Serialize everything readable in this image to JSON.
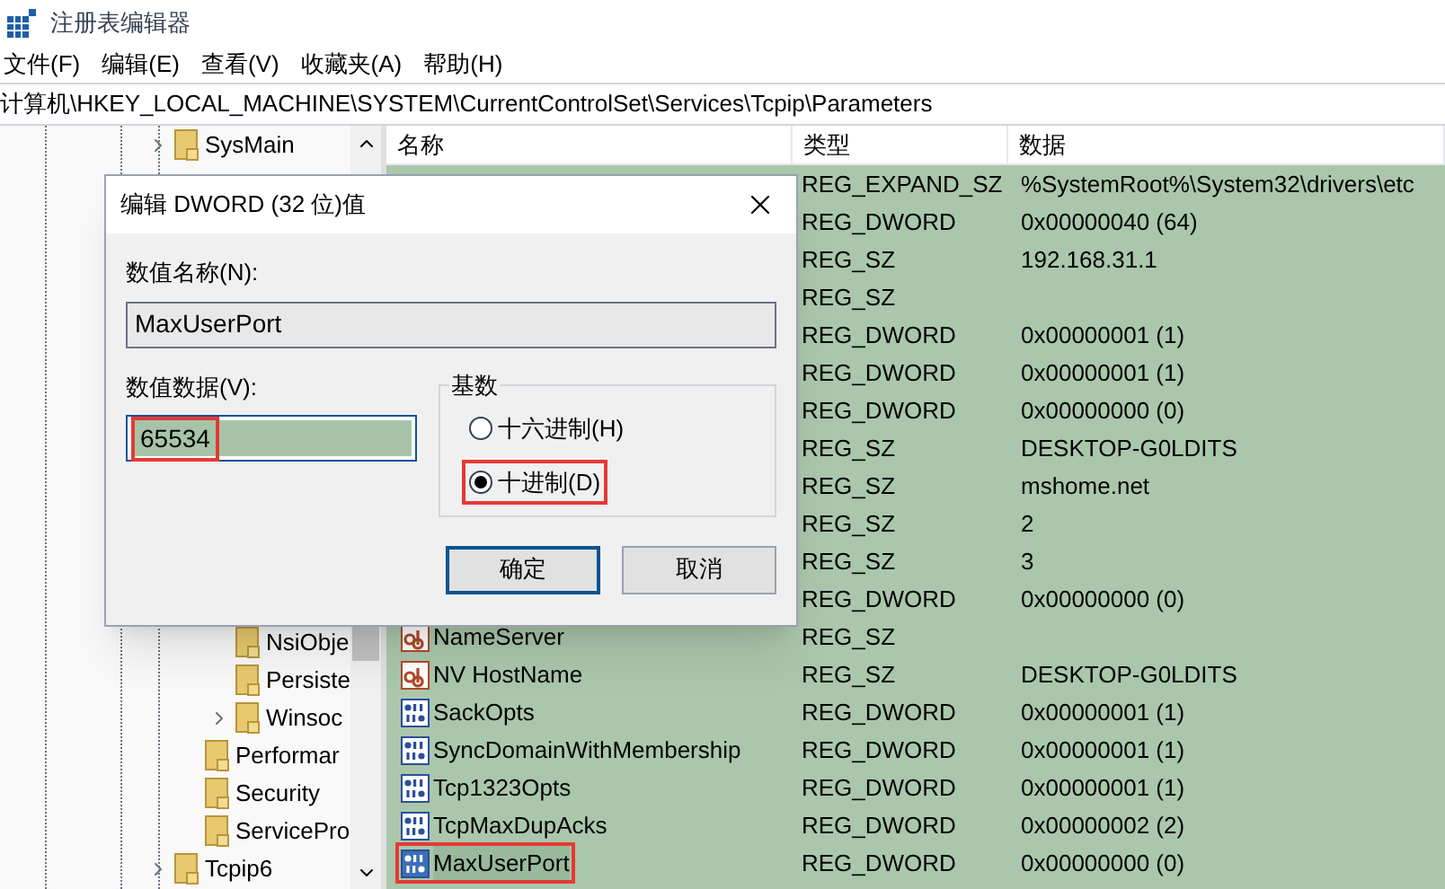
{
  "window": {
    "title": "注册表编辑器"
  },
  "menu": [
    "文件(F)",
    "编辑(E)",
    "查看(V)",
    "收藏夹(A)",
    "帮助(H)"
  ],
  "address": "计算机\\HKEY_LOCAL_MACHINE\\SYSTEM\\CurrentControlSet\\Services\\Tcpip\\Parameters",
  "tree": {
    "items": [
      {
        "label": "SysMain",
        "expandable": true
      },
      {
        "children": [
          {
            "children": [
              {
                "label": "NsiObje",
                "expandable": false
              },
              {
                "label": "Persiste",
                "expandable": false
              },
              {
                "label": "Winsoc",
                "expandable": true
              }
            ]
          },
          {
            "label": "Performar",
            "expandable": false
          },
          {
            "label": "Security",
            "expandable": false
          },
          {
            "label": "ServicePro",
            "expandable": false
          }
        ]
      },
      {
        "label": "Tcpip6",
        "expandable": true
      }
    ]
  },
  "table": {
    "columns": [
      "名称",
      "类型",
      "数据"
    ],
    "rows": [
      {
        "type": "REG_EXPAND_SZ",
        "data": "%SystemRoot%\\System32\\drivers\\etc"
      },
      {
        "type": "REG_DWORD",
        "data": "0x00000040 (64)"
      },
      {
        "type": "REG_SZ",
        "data": "192.168.31.1"
      },
      {
        "type": "REG_SZ"
      },
      {
        "type": "REG_DWORD",
        "data": "0x00000001 (1)"
      },
      {
        "type": "REG_DWORD",
        "data": "0x00000001 (1)"
      },
      {
        "type": "REG_DWORD",
        "data": "0x00000000 (0)"
      },
      {
        "type": "REG_SZ",
        "data": "DESKTOP-G0LDITS"
      },
      {
        "type": "REG_SZ",
        "data": "mshome.net"
      },
      {
        "type": "REG_SZ",
        "data": "2"
      },
      {
        "type": "REG_SZ",
        "data": "3"
      },
      {
        "type": "REG_DWORD",
        "data": "0x00000000 (0)"
      },
      {
        "name": "NameServer",
        "kind": "string",
        "type": "REG_SZ",
        "selected": false,
        "annotated": false
      },
      {
        "name": "NV HostName",
        "kind": "string",
        "type": "REG_SZ",
        "data": "DESKTOP-G0LDITS",
        "selected": false,
        "annotated": false
      },
      {
        "name": "SackOpts",
        "kind": "binary",
        "type": "REG_DWORD",
        "data": "0x00000001 (1)",
        "selected": false,
        "annotated": false
      },
      {
        "name": "SyncDomainWithMembership",
        "kind": "binary",
        "type": "REG_DWORD",
        "data": "0x00000001 (1)",
        "selected": false,
        "annotated": false
      },
      {
        "name": "Tcp1323Opts",
        "kind": "binary",
        "type": "REG_DWORD",
        "data": "0x00000001 (1)",
        "selected": false,
        "annotated": false
      },
      {
        "name": "TcpMaxDupAcks",
        "kind": "binary",
        "type": "REG_DWORD",
        "data": "0x00000002 (2)",
        "selected": false,
        "annotated": false
      },
      {
        "name": "MaxUserPort",
        "kind": "binary",
        "type": "REG_DWORD",
        "data": "0x00000000 (0)",
        "selected": true,
        "annotated": true
      }
    ]
  },
  "dialog": {
    "title": "编辑 DWORD (32 位)值",
    "name_label": "数值名称(N):",
    "name_value": "MaxUserPort",
    "data_label": "数值数据(V):",
    "data_value": "65534",
    "data_annotated": true,
    "base_label": "基数",
    "radios": [
      {
        "label": "十六进制(H)",
        "selected": false,
        "annotated": false
      },
      {
        "label": "十进制(D)",
        "selected": true,
        "annotated": true
      }
    ],
    "buttons": [
      {
        "label": "确定",
        "default": true
      },
      {
        "label": "取消",
        "default": false
      }
    ]
  }
}
